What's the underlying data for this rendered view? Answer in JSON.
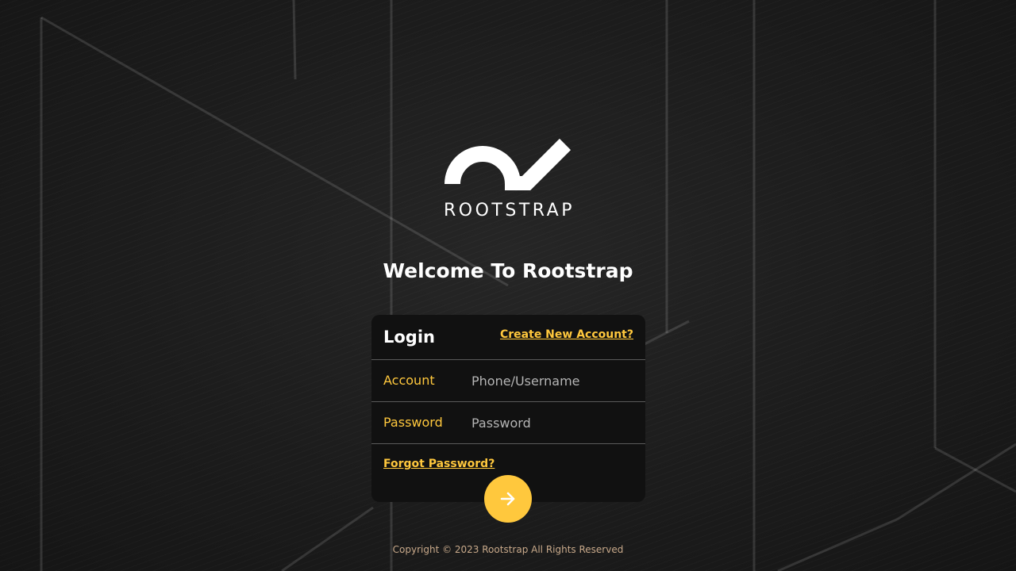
{
  "brand": {
    "logo_icon": "rootstrap-wave-logo",
    "wordmark": "ROOTSTRAP"
  },
  "welcome_title": "Welcome To Rootstrap",
  "login_card": {
    "title": "Login",
    "create_account_link": "Create New Account?",
    "account": {
      "label": "Account",
      "placeholder": "Phone/Username",
      "value": ""
    },
    "password": {
      "label": "Password",
      "placeholder": "Password",
      "value": ""
    },
    "forgot_password_link": "Forgot Password?",
    "submit_icon": "arrow-right-icon"
  },
  "footer": {
    "copyright": "Copyright © 2023 Rootstrap All Rights Reserved"
  },
  "colors": {
    "accent": "#ffc83d",
    "card_bg": "#111111",
    "page_bg": "#1b1b1b",
    "text": "#ffffff"
  }
}
